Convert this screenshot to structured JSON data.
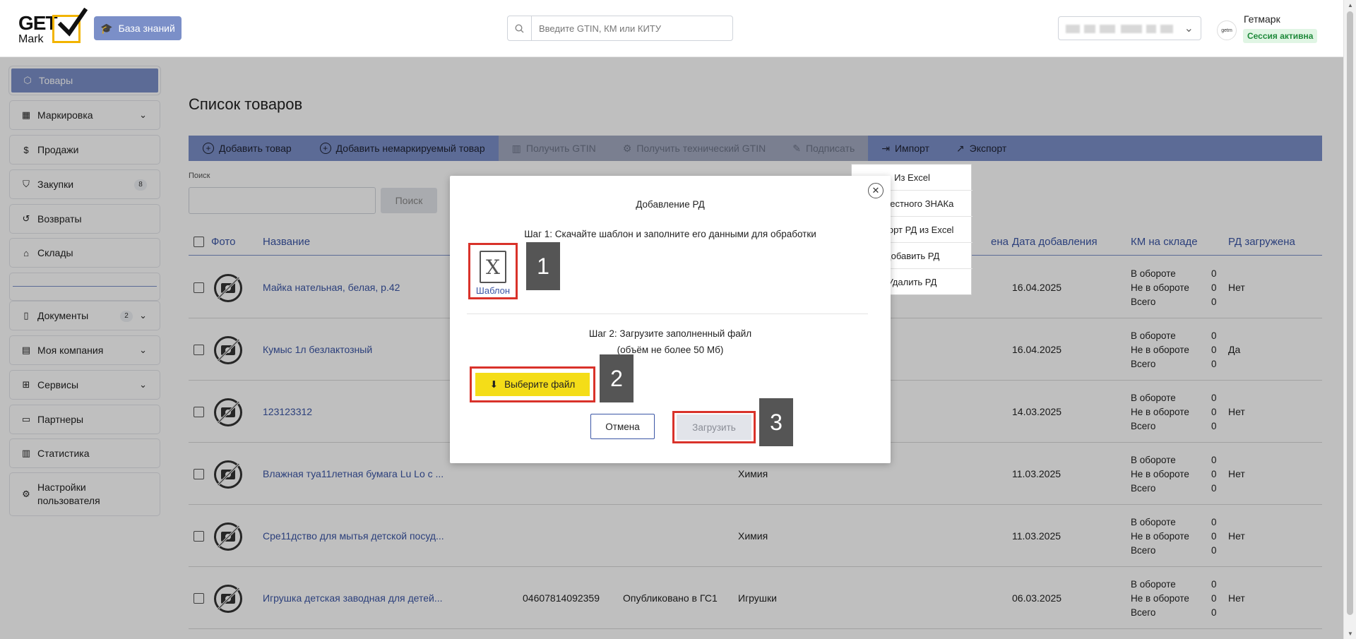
{
  "header": {
    "logo_get": "GET",
    "logo_mark": "Mark",
    "kb_label": "База знаний",
    "search_placeholder": "Введите GTIN, КМ или КИТУ",
    "user_name": "Гетмарк",
    "session_badge": "Сессия активна",
    "avatar_text": "getm"
  },
  "sidebar": {
    "items": [
      {
        "label": "Товары",
        "icon": "box-icon",
        "active": true
      },
      {
        "label": "Маркировка",
        "icon": "qr-icon",
        "chevron": true
      },
      {
        "label": "Продажи",
        "icon": "dollar-icon"
      },
      {
        "label": "Закупки",
        "icon": "bag-icon",
        "count": "8"
      },
      {
        "label": "Возвраты",
        "icon": "return-icon"
      },
      {
        "label": "Склады",
        "icon": "warehouse-icon"
      },
      {
        "label": "Документы",
        "icon": "document-icon",
        "count": "2",
        "chevron": true
      },
      {
        "label": "Моя компания",
        "icon": "building-icon",
        "chevron": true
      },
      {
        "label": "Сервисы",
        "icon": "grid-icon",
        "chevron": true
      },
      {
        "label": "Партнеры",
        "icon": "partners-icon"
      },
      {
        "label": "Статистика",
        "icon": "chart-icon"
      },
      {
        "label": "Настройки пользователя",
        "icon": "settings-icon"
      }
    ]
  },
  "main": {
    "title": "Список товаров",
    "toolbar": {
      "add_product": "Добавить товар",
      "add_unmarked": "Добавить немаркируемый товар",
      "get_gtin": "Получить GTIN",
      "get_tech_gtin": "Получить технический GTIN",
      "sign": "Подписать",
      "import": "Импорт",
      "export": "Экспорт"
    },
    "search_label": "Поиск",
    "search_button": "Поиск",
    "columns": {
      "photo": "Фото",
      "name": "Название",
      "price_partial": "ена",
      "date_added": "Дата добавления",
      "km_stock": "КМ на складе",
      "rd_loaded": "РД загружена"
    },
    "km_labels": [
      "В обороте",
      "Не в обороте",
      "Всего"
    ],
    "rows": [
      {
        "name": "Майка нательная, белая, р.42",
        "gtin": "",
        "status": "",
        "category": "",
        "date": "16.04.2025",
        "km": [
          "0",
          "0",
          "0"
        ],
        "rd": "Нет"
      },
      {
        "name": "Кумыс 1л безлактозный",
        "gtin": "",
        "status": "",
        "category": "",
        "date": "16.04.2025",
        "km": [
          "0",
          "0",
          "0"
        ],
        "rd": "Да"
      },
      {
        "name": "123123312",
        "gtin": "",
        "status": "",
        "category": "",
        "date": "14.03.2025",
        "km": [
          "0",
          "0",
          "0"
        ],
        "rd": "Нет"
      },
      {
        "name": "Влажная туа11летная бумага Lu Lo с ...",
        "gtin": "",
        "status": "",
        "category": "Химия",
        "date": "11.03.2025",
        "km": [
          "0",
          "0",
          "0"
        ],
        "rd": "Нет"
      },
      {
        "name": "Сре11дство для мытья детской посуд...",
        "gtin": "",
        "status": "",
        "category": "Химия",
        "date": "11.03.2025",
        "km": [
          "0",
          "0",
          "0"
        ],
        "rd": "Нет"
      },
      {
        "name": "Игрушка детская заводная для детей...",
        "gtin": "04607814092359",
        "status": "Опубликовано в ГС1",
        "category": "Игрушки",
        "date": "06.03.2025",
        "km": [
          "0",
          "0",
          "0"
        ],
        "rd": "Нет"
      }
    ]
  },
  "import_dropdown": {
    "items": [
      "Из Excel",
      "Из Честного ЗНАКа",
      "Импорт РД из Excel",
      "Добавить РД",
      "Удалить РД"
    ]
  },
  "modal": {
    "title": "Добавление РД",
    "step1": "Шаг 1: Скачайте шаблон и заполните его данными для обработки",
    "template_label": "Шаблон",
    "step2": "Шаг 2: Загрузите заполненный файл",
    "volume_note": "(объём не более 50 Мб)",
    "choose_file": "Выберите файл",
    "cancel": "Отмена",
    "upload": "Загрузить"
  },
  "callouts": [
    "1",
    "2",
    "3"
  ]
}
